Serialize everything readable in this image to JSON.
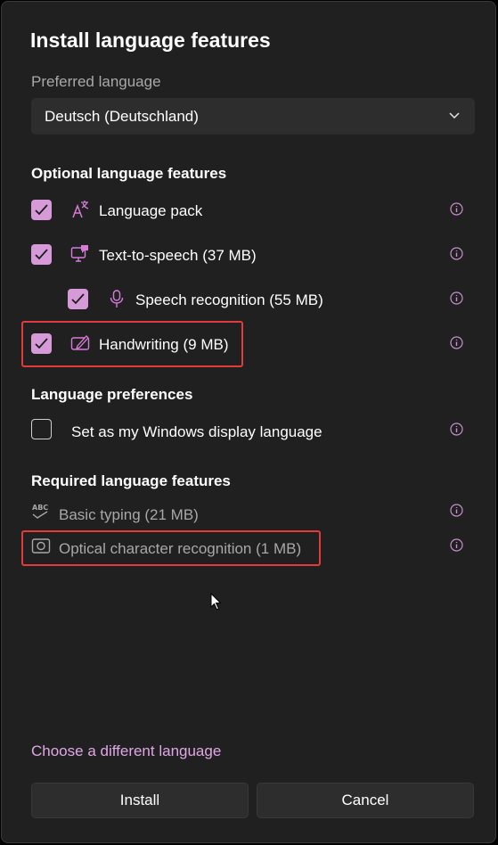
{
  "dialog": {
    "title": "Install language features",
    "preferred_label": "Preferred language",
    "preferred_value": "Deutsch (Deutschland)"
  },
  "optional": {
    "heading": "Optional language features",
    "items": [
      {
        "label": "Language pack",
        "checked": true,
        "icon": "language-pack-icon"
      },
      {
        "label": "Text-to-speech (37 MB)",
        "checked": true,
        "icon": "text-to-speech-icon"
      },
      {
        "label": "Speech recognition (55 MB)",
        "checked": true,
        "icon": "microphone-icon"
      },
      {
        "label": "Handwriting (9 MB)",
        "checked": true,
        "icon": "handwriting-icon",
        "highlighted": true
      }
    ]
  },
  "preferences": {
    "heading": "Language preferences",
    "display_language_label": "Set as my Windows display language",
    "display_language_checked": false
  },
  "required": {
    "heading": "Required language features",
    "items": [
      {
        "label": "Basic typing (21 MB)",
        "icon": "abc-typing-icon"
      },
      {
        "label": "Optical character recognition (1 MB)",
        "icon": "ocr-icon",
        "highlighted": true
      }
    ]
  },
  "footer": {
    "link": "Choose a different language",
    "install": "Install",
    "cancel": "Cancel"
  },
  "colors": {
    "background": "#202020",
    "accent": "#d79ad9",
    "link": "#e0a7e6",
    "highlight_box": "#e23b3b"
  }
}
